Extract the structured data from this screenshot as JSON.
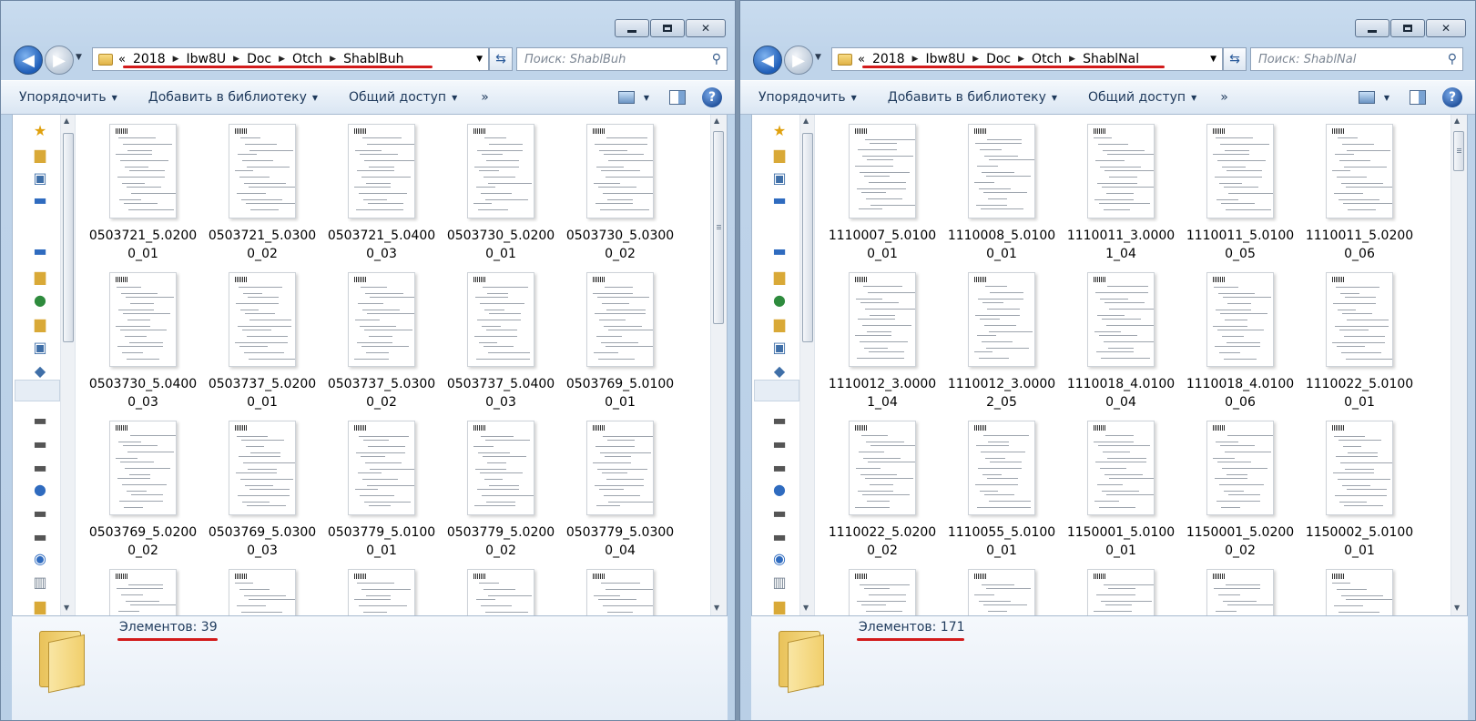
{
  "left": {
    "breadcrumb": [
      "2018",
      "Ibw8U",
      "Doc",
      "Otch",
      "ShablBuh"
    ],
    "search_placeholder": "Поиск: ShablBuh",
    "toolbar": {
      "organize": "Упорядочить",
      "add_library": "Добавить в библиотеку",
      "share": "Общий доступ",
      "more": "»"
    },
    "files": [
      "0503721_5.02000_01",
      "0503721_5.03000_02",
      "0503721_5.04000_03",
      "0503730_5.02000_01",
      "0503730_5.03000_02",
      "0503730_5.04000_03",
      "0503737_5.02000_01",
      "0503737_5.03000_02",
      "0503737_5.04000_03",
      "0503769_5.01000_01",
      "0503769_5.02000_02",
      "0503769_5.03000_03",
      "0503779_5.01000_01",
      "0503779_5.02000_02",
      "0503779_5.03000_04",
      "",
      "",
      "",
      "",
      ""
    ],
    "status": "Элементов: 39"
  },
  "right": {
    "breadcrumb": [
      "2018",
      "Ibw8U",
      "Doc",
      "Otch",
      "ShablNal"
    ],
    "search_placeholder": "Поиск: ShablNal",
    "toolbar": {
      "organize": "Упорядочить",
      "add_library": "Добавить в библиотеку",
      "share": "Общий доступ",
      "more": "»"
    },
    "files": [
      "1110007_5.01000_01",
      "1110008_5.01000_01",
      "1110011_3.00001_04",
      "1110011_5.01000_05",
      "1110011_5.02000_06",
      "1110012_3.00001_04",
      "1110012_3.00002_05",
      "1110018_4.01000_04",
      "1110018_4.01000_06",
      "1110022_5.01000_01",
      "1110022_5.02000_02",
      "1110055_5.01000_01",
      "1150001_5.01000_01",
      "1150001_5.02000_02",
      "1150002_5.01000_01",
      "",
      "",
      "",
      "",
      ""
    ],
    "status": "Элементов: 171"
  },
  "accent": {
    "underline": "#d21b1b",
    "link": "#1f3b5d"
  }
}
